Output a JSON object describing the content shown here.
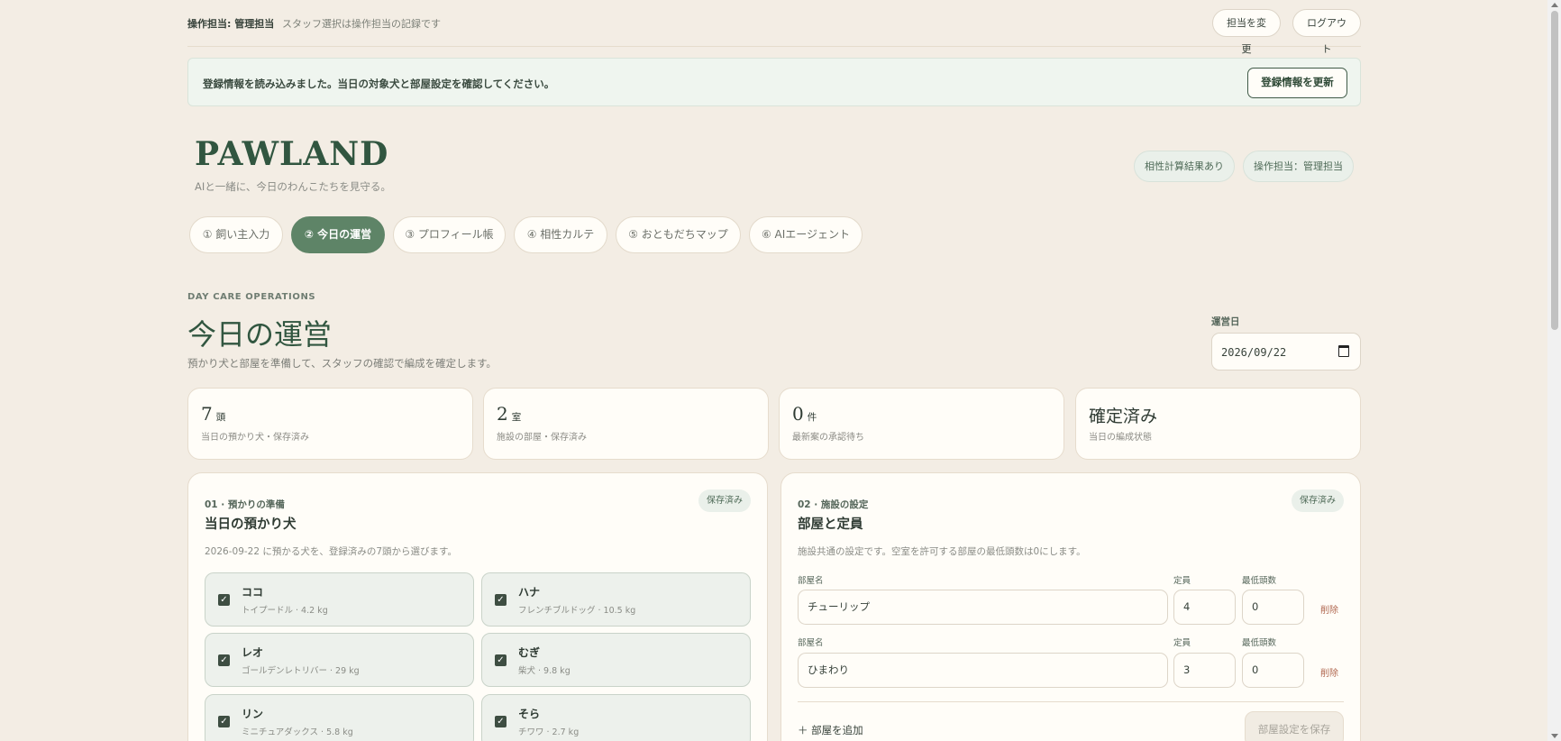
{
  "topbar": {
    "operator": "操作担当: 管理担当",
    "note": "スタッフ選択は操作担当の記録です",
    "change_label": "担当を変更",
    "logout_label": "ログアウト"
  },
  "notice": {
    "message": "登録情報を読み込みました。当日の対象犬と部屋設定を確認してください。",
    "refresh_label": "登録情報を更新"
  },
  "header": {
    "brand": "PAWLAND",
    "tagline": "AIと一緒に、今日のわんこたちを見守る。",
    "status_compat": "相性計算結果あり",
    "status_operator": "操作担当：管理担当"
  },
  "tabs": [
    {
      "label": "① 飼い主入力"
    },
    {
      "label": "② 今日の運営"
    },
    {
      "label": "③ プロフィール帳"
    },
    {
      "label": "④ 相性カルテ"
    },
    {
      "label": "⑤ おともだちマップ"
    },
    {
      "label": "⑥ AIエージェント"
    }
  ],
  "section": {
    "eyebrow": "DAY CARE OPERATIONS",
    "title": "今日の運営",
    "description": "預かり犬と部屋を準備して、スタッフの確認で編成を確定します。",
    "date_label": "運営日",
    "date_value": "2026/09/22"
  },
  "stats": [
    {
      "value": "7",
      "unit": "頭",
      "label": "当日の預かり犬・保存済み"
    },
    {
      "value": "2",
      "unit": "室",
      "label": "施設の部屋・保存済み"
    },
    {
      "value": "0",
      "unit": "件",
      "label": "最新案の承認待ち"
    },
    {
      "value": "確定済み",
      "unit": "",
      "label": "当日の編成状態"
    }
  ],
  "dogs_panel": {
    "step": "01 · 預かりの準備",
    "title": "当日の預かり犬",
    "badge": "保存済み",
    "description": "2026-09-22 に預かる犬を、登録済みの7頭から選びます。",
    "dogs": [
      {
        "name": "ココ",
        "meta": "トイプードル · 4.2 kg",
        "checked": true
      },
      {
        "name": "ハナ",
        "meta": "フレンチブルドッグ · 10.5 kg",
        "checked": true
      },
      {
        "name": "レオ",
        "meta": "ゴールデンレトリバー · 29 kg",
        "checked": true
      },
      {
        "name": "むぎ",
        "meta": "柴犬 · 9.8 kg",
        "checked": true
      },
      {
        "name": "リン",
        "meta": "ミニチュアダックス · 5.8 kg",
        "checked": true
      },
      {
        "name": "そら",
        "meta": "チワワ · 2.7 kg",
        "checked": true
      }
    ]
  },
  "rooms_panel": {
    "step": "02 · 施設の設定",
    "title": "部屋と定員",
    "badge": "保存済み",
    "description": "施設共通の設定です。空室を許可する部屋の最低頭数は0にします。",
    "col_name": "部屋名",
    "col_capacity": "定員",
    "col_min": "最低頭数",
    "delete_label": "削除",
    "rooms": [
      {
        "name": "チューリップ",
        "capacity": "4",
        "min": "0"
      },
      {
        "name": "ひまわり",
        "capacity": "3",
        "min": "0"
      }
    ],
    "add_label": "＋ 部屋を追加",
    "save_label": "部屋設定を保存"
  },
  "colors": {
    "background": "#f3ede4",
    "brand": "#315640",
    "active_tab": "#5e8467",
    "card": "#fffdf8"
  }
}
